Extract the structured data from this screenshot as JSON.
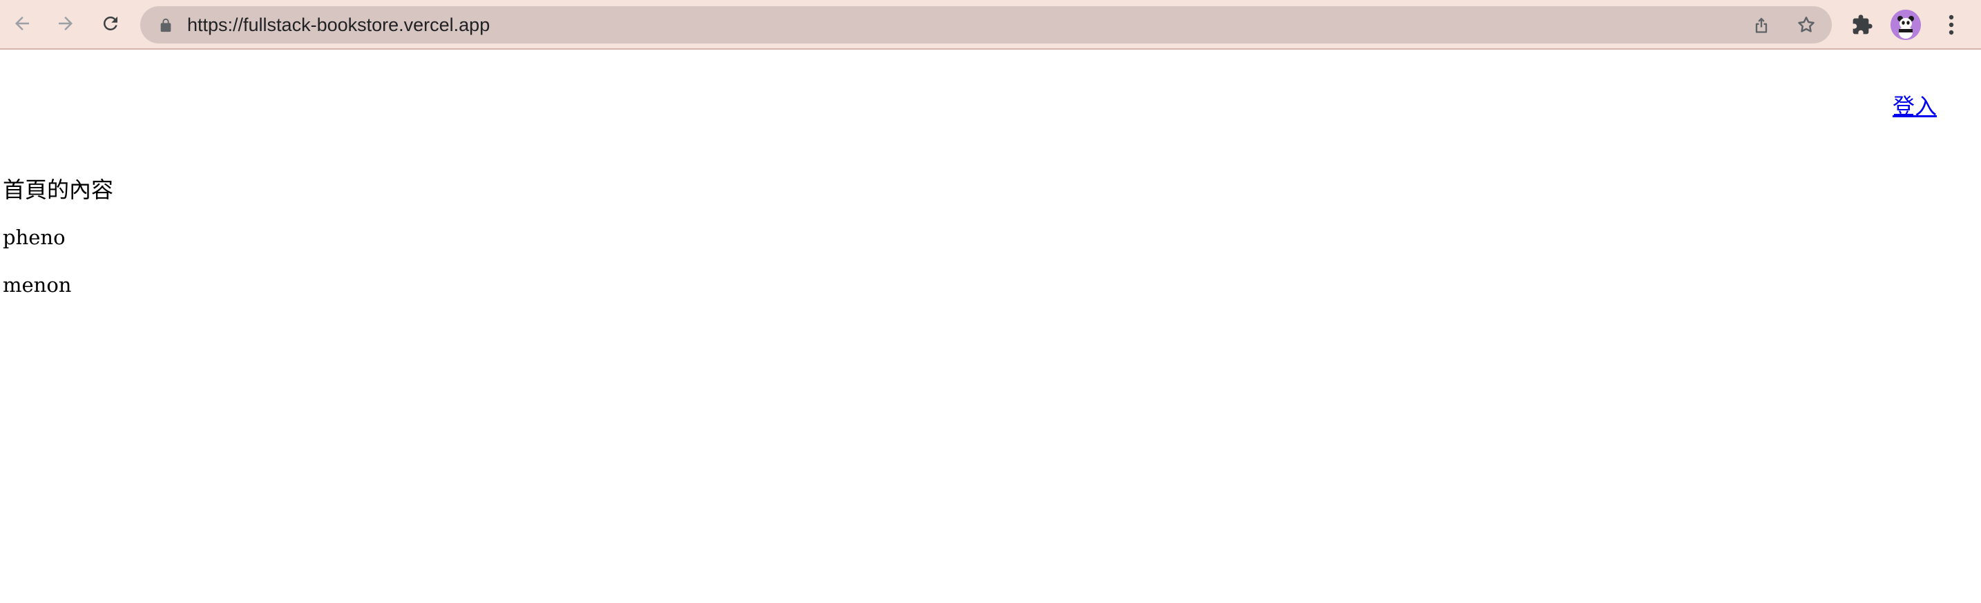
{
  "browser": {
    "url": "https://fullstack-bookstore.vercel.app",
    "toolbar_color": "#f5e3dc",
    "omnibox_color": "#d6c5c0",
    "icons": [
      "back-arrow-icon",
      "forward-arrow-icon",
      "reload-icon",
      "lock-icon",
      "share-icon",
      "star-icon",
      "extensions-icon",
      "profile-avatar",
      "more-menu-icon"
    ]
  },
  "page": {
    "login_label": "登入",
    "home_content": "首頁的內容",
    "paragraphs": [
      "pheno",
      "menon"
    ],
    "link_color": "#0000ee"
  }
}
